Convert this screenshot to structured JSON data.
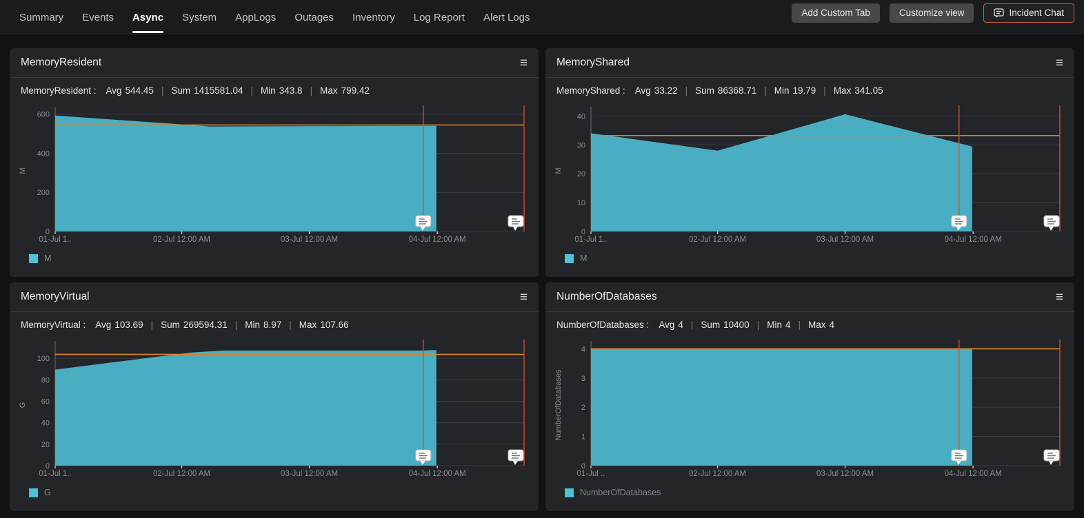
{
  "ui": {
    "separator": "|",
    "menu_icon_glyph": "≡"
  },
  "colors": {
    "area": "#4aaec3",
    "legend_swatch": "#4ec1d8",
    "threshold": "#d8812c",
    "vline": "#c85032",
    "grid": "#3c3d42",
    "axis": "#6a6b6e",
    "tick": "#8b8e94"
  },
  "nav": {
    "tabs": [
      {
        "label": "Summary",
        "active": false
      },
      {
        "label": "Events",
        "active": false
      },
      {
        "label": "Async",
        "active": true
      },
      {
        "label": "System",
        "active": false
      },
      {
        "label": "AppLogs",
        "active": false
      },
      {
        "label": "Outages",
        "active": false
      },
      {
        "label": "Inventory",
        "active": false
      },
      {
        "label": "Log Report",
        "active": false
      },
      {
        "label": "Alert Logs",
        "active": false
      }
    ],
    "buttons": {
      "add_custom_tab": "Add Custom Tab",
      "customize_view": "Customize view",
      "incident_chat": "Incident Chat"
    }
  },
  "panels": [
    {
      "title": "MemoryResident",
      "metric_label": "MemoryResident :",
      "stats": [
        {
          "label": "Avg",
          "value": "544.45"
        },
        {
          "label": "Sum",
          "value": "1415581.04"
        },
        {
          "label": "Min",
          "value": "343.8"
        },
        {
          "label": "Max",
          "value": "799.42"
        }
      ],
      "chart_data": {
        "type": "area",
        "ylabel": "M",
        "legend": "M",
        "ylim": [
          0,
          620
        ],
        "yticks": [
          0,
          200,
          400,
          600
        ],
        "xticks": [
          {
            "f": 0,
            "label": "01-Jul 1.."
          },
          {
            "f": 0.27,
            "label": "02-Jul 12:00 AM"
          },
          {
            "f": 0.542,
            "label": "03-Jul 12:00 AM"
          },
          {
            "f": 0.815,
            "label": "04-Jul 12:00 AM"
          }
        ],
        "points": [
          [
            0,
            593
          ],
          [
            0.25,
            551
          ],
          [
            0.33,
            537
          ],
          [
            0.5,
            538
          ],
          [
            0.813,
            540
          ]
        ],
        "threshold": 544.45,
        "annotations": [
          0.785,
          1.0
        ],
        "grid": true,
        "legend_position": "bottom-left"
      }
    },
    {
      "title": "MemoryShared",
      "metric_label": "MemoryShared :",
      "stats": [
        {
          "label": "Avg",
          "value": "33.22"
        },
        {
          "label": "Sum",
          "value": "86368.71"
        },
        {
          "label": "Min",
          "value": "19.79"
        },
        {
          "label": "Max",
          "value": "341.05"
        }
      ],
      "chart_data": {
        "type": "area",
        "ylabel": "M",
        "legend": "M",
        "ylim": [
          0,
          42
        ],
        "yticks": [
          0,
          10,
          20,
          30,
          40
        ],
        "xticks": [
          {
            "f": 0,
            "label": "01-Jul 1.."
          },
          {
            "f": 0.27,
            "label": "02-Jul 12:00 AM"
          },
          {
            "f": 0.542,
            "label": "03-Jul 12:00 AM"
          },
          {
            "f": 0.815,
            "label": "04-Jul 12:00 AM"
          }
        ],
        "points": [
          [
            0,
            34
          ],
          [
            0.27,
            28
          ],
          [
            0.542,
            40.6
          ],
          [
            0.813,
            29.4
          ]
        ],
        "threshold": 33.22,
        "annotations": [
          0.785,
          1.0
        ],
        "grid": true,
        "legend_position": "bottom-left"
      }
    },
    {
      "title": "MemoryVirtual",
      "metric_label": "MemoryVirtual :",
      "stats": [
        {
          "label": "Avg",
          "value": "103.69"
        },
        {
          "label": "Sum",
          "value": "269594.31"
        },
        {
          "label": "Min",
          "value": "8.97"
        },
        {
          "label": "Max",
          "value": "107.66"
        }
      ],
      "chart_data": {
        "type": "area",
        "ylabel": "G",
        "legend": "G",
        "ylim": [
          0,
          113
        ],
        "yticks": [
          0,
          20,
          40,
          60,
          80,
          100
        ],
        "xticks": [
          {
            "f": 0,
            "label": "01-Jul 1.."
          },
          {
            "f": 0.27,
            "label": "02-Jul 12:00 AM"
          },
          {
            "f": 0.542,
            "label": "03-Jul 12:00 AM"
          },
          {
            "f": 0.815,
            "label": "04-Jul 12:00 AM"
          }
        ],
        "points": [
          [
            0,
            89.5
          ],
          [
            0.29,
            105.5
          ],
          [
            0.36,
            107.3
          ],
          [
            0.78,
            107.3
          ],
          [
            0.813,
            107.7
          ]
        ],
        "threshold": 103.69,
        "annotations": [
          0.785,
          1.0
        ],
        "grid": true,
        "legend_position": "bottom-left"
      }
    },
    {
      "title": "NumberOfDatabases",
      "metric_label": "NumberOfDatabases :",
      "stats": [
        {
          "label": "Avg",
          "value": "4"
        },
        {
          "label": "Sum",
          "value": "10400"
        },
        {
          "label": "Min",
          "value": "4"
        },
        {
          "label": "Max",
          "value": "4"
        }
      ],
      "chart_data": {
        "type": "area",
        "ylabel": "NumberOfDatabases",
        "legend": "NumberOfDatabases",
        "ylim": [
          0,
          4.15
        ],
        "yticks": [
          0,
          1,
          2,
          3,
          4
        ],
        "xticks": [
          {
            "f": 0,
            "label": "01-Jul .."
          },
          {
            "f": 0.27,
            "label": "02-Jul 12:00 AM"
          },
          {
            "f": 0.542,
            "label": "03-Jul 12:00 AM"
          },
          {
            "f": 0.815,
            "label": "04-Jul 12:00 AM"
          }
        ],
        "points": [
          [
            0,
            4
          ],
          [
            0.813,
            4
          ]
        ],
        "threshold": 4,
        "annotations": [
          0.785,
          1.0
        ],
        "grid": true,
        "legend_position": "bottom-left"
      }
    }
  ]
}
